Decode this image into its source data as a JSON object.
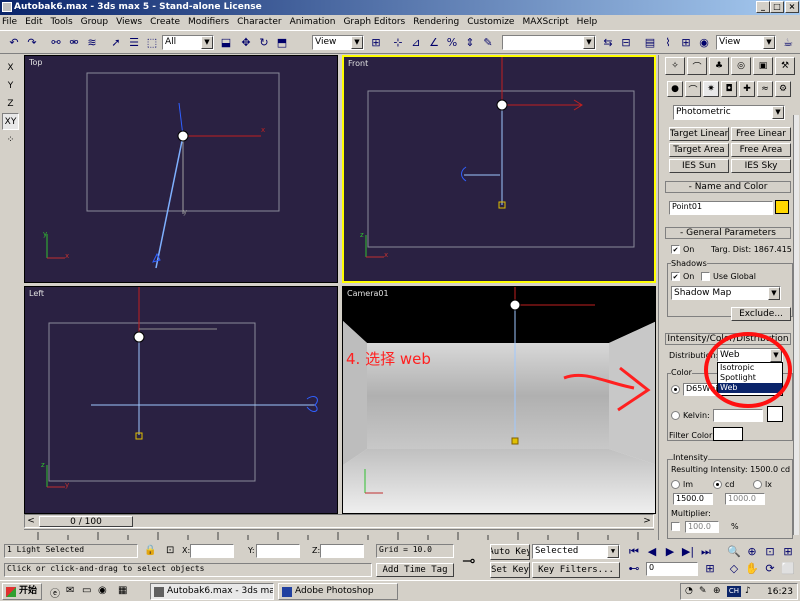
{
  "window": {
    "title": "Autobak6.max - 3ds max 5 - Stand-alone License",
    "controls": [
      "_",
      "□",
      "×"
    ]
  },
  "menu": [
    "File",
    "Edit",
    "Tools",
    "Group",
    "Views",
    "Create",
    "Modifiers",
    "Character",
    "Animation",
    "Graph Editors",
    "Rendering",
    "Customize",
    "MAXScript",
    "Help"
  ],
  "toolbar": {
    "selection_filter": "All",
    "reference_coord": "View",
    "named_selection": "",
    "render_view": "View"
  },
  "axis_buttons": [
    "X",
    "Y",
    "Z",
    "XY"
  ],
  "viewports": {
    "top": "Top",
    "front": "Front",
    "left": "Left",
    "camera": "Camera01"
  },
  "annotation": "4. 选择 web",
  "command_panel": {
    "category": "Photometric",
    "light_buttons": [
      "Target Linear",
      "Free Linear",
      "Target Area",
      "Free Area",
      "IES Sun",
      "IES Sky"
    ],
    "name_color": {
      "header": "Name and Color",
      "object_name": "Point01",
      "color": "#ffd700"
    },
    "general": {
      "header": "General Parameters",
      "on_label": "On",
      "targ_dist": "Targ. Dist: 1867.415",
      "shadows_label": "Shadows",
      "shadows_on_label": "On",
      "use_global_label": "Use Global",
      "shadow_type": "Shadow Map",
      "exclude_label": "Exclude..."
    },
    "intensity_rollout": {
      "header": "Intensity/Color/Distribution",
      "distribution_label": "Distribution:",
      "distribution_value": "Web",
      "distribution_options": [
        "Isotropic",
        "Spotlight",
        "Web"
      ],
      "selected_option": "Web",
      "color_label": "Color",
      "color_preset": "D65White",
      "kelvin_label": "Kelvin:",
      "filter_color_label": "Filter Color:",
      "intensity_label": "Intensity",
      "resulting_intensity": "Resulting Intensity: 1500.0 cd",
      "units": [
        "lm",
        "cd",
        "lx"
      ],
      "selected_unit": "cd",
      "value_1": "1500.0",
      "value_2": "1000.0",
      "multiplier_label": "Multiplier:",
      "multiplier_value": "100.0",
      "multiplier_unit": "%"
    }
  },
  "timeline": {
    "frame_display": "0 / 100"
  },
  "status": {
    "selection": "1 Light Selected",
    "prompt": "Click or click-and-drag to select objects",
    "x_label": "X:",
    "y_label": "Y:",
    "z_label": "Z:",
    "grid": "Grid = 10.0",
    "add_time_tag": "Add Time Tag",
    "auto_key": "Auto Key",
    "set_key": "Set Key",
    "key_mode": "Selected",
    "key_filters": "Key Filters...",
    "current_frame": "0"
  },
  "taskbar": {
    "start": "开始",
    "tasks": [
      "Autobak6.max - 3ds max ...",
      "Adobe Photoshop"
    ],
    "clock": "16:23",
    "ime": "CH"
  }
}
